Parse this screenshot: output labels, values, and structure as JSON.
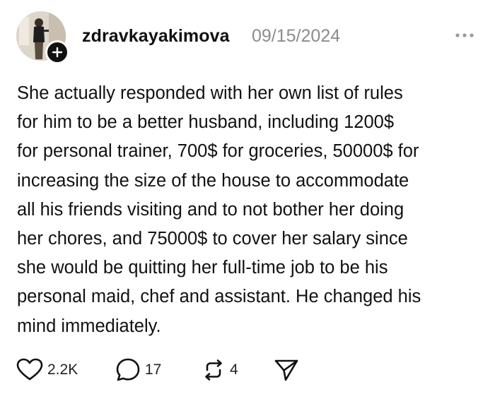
{
  "post": {
    "username": "zdravkayakimova",
    "date": "09/15/2024",
    "lines": [
      "She actually responded with her own list of rules",
      "for him to be a better husband, including 1200$",
      "for personal trainer, 700$ for groceries, 50000$ for",
      "increasing the size of the house to accommodate",
      "all his friends visiting and to not bother her doing",
      "her chores, and 75000$ to cover her salary since",
      "she would be quitting her full-time job to be his",
      "personal maid, chef and assistant. He changed his",
      "mind immediately."
    ]
  },
  "actions": {
    "likes": "2.2K",
    "replies": "17",
    "reposts": "4"
  },
  "icons": {
    "avatar": "profile-photo",
    "follow": "plus-icon",
    "more": "more-dots-icon",
    "like": "heart-icon",
    "reply": "comment-icon",
    "repost": "repost-icon",
    "share": "send-icon"
  }
}
